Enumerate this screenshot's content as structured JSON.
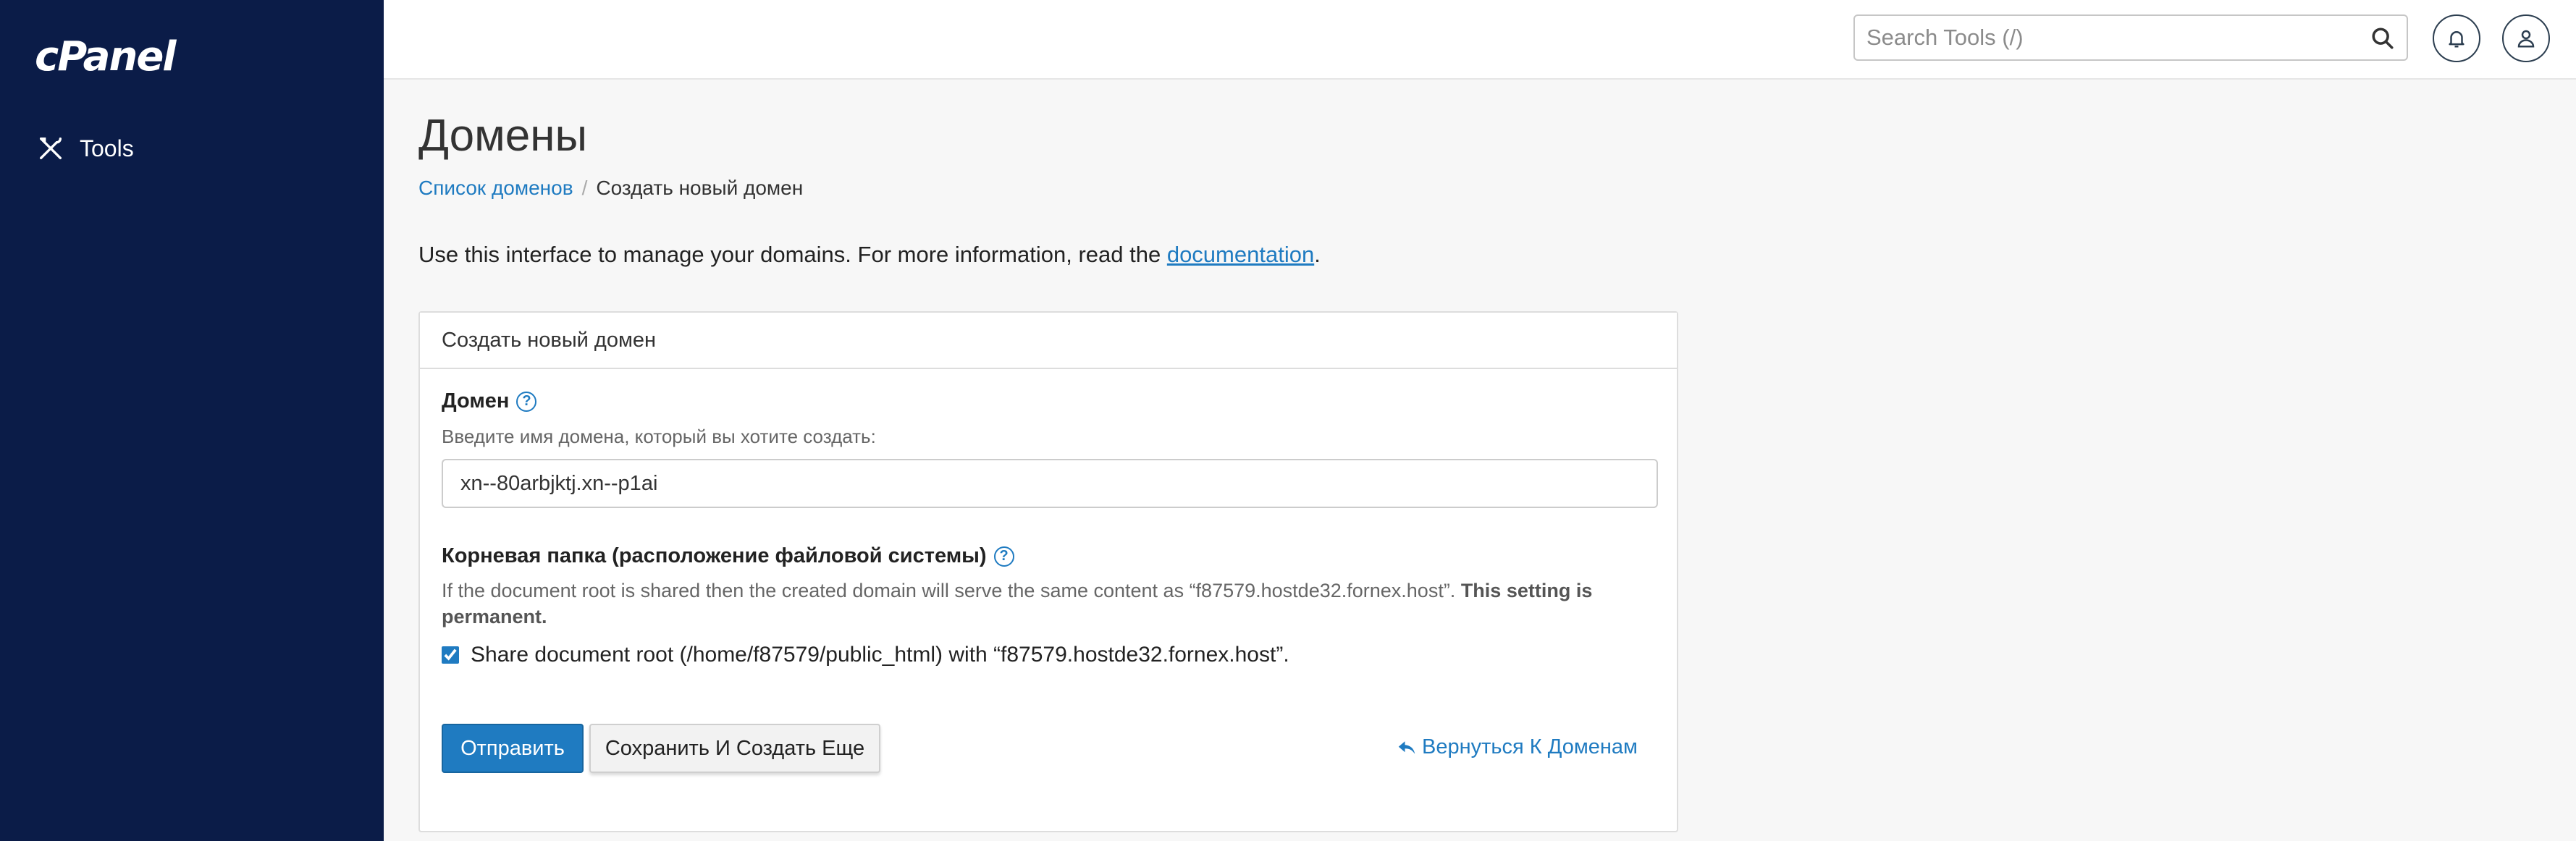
{
  "brand": {
    "logo_text": "cPanel"
  },
  "sidebar": {
    "items": [
      {
        "label": "Tools",
        "icon": "tools-icon"
      }
    ]
  },
  "header": {
    "search": {
      "placeholder": "Search Tools (/)",
      "value": ""
    },
    "notifications_icon": "bell-icon",
    "user_icon": "user-icon"
  },
  "page": {
    "title": "Домены",
    "breadcrumb": {
      "parent": "Список доменов",
      "current": "Создать новый домен"
    },
    "intro": {
      "text": "Use this interface to manage your domains. For more information, read the ",
      "link": "documentation",
      "end": "."
    }
  },
  "form": {
    "panel_title": "Создать новый домен",
    "domain": {
      "label": "Домен",
      "hint": "Введите имя домена, который вы хотите создать:",
      "value": "xn--80arbjktj.xn--p1ai"
    },
    "docroot": {
      "label": "Корневая папка (расположение файловой системы)",
      "description": "If the document root is shared then the created domain will serve the same content as “f87579.hostde32.fornex.host”. ",
      "description_bold": "This setting is permanent.",
      "checkbox_label": "Share document root (/home/f87579/public_html) with “f87579.hostde32.fornex.host”.",
      "checked": true
    },
    "buttons": {
      "submit": "Отправить",
      "save_and_create": "Сохранить И Создать Еще",
      "back": "Вернуться К Доменам"
    }
  },
  "colors": {
    "sidebar": "#0b1c48",
    "accent": "#1f7bc1"
  }
}
